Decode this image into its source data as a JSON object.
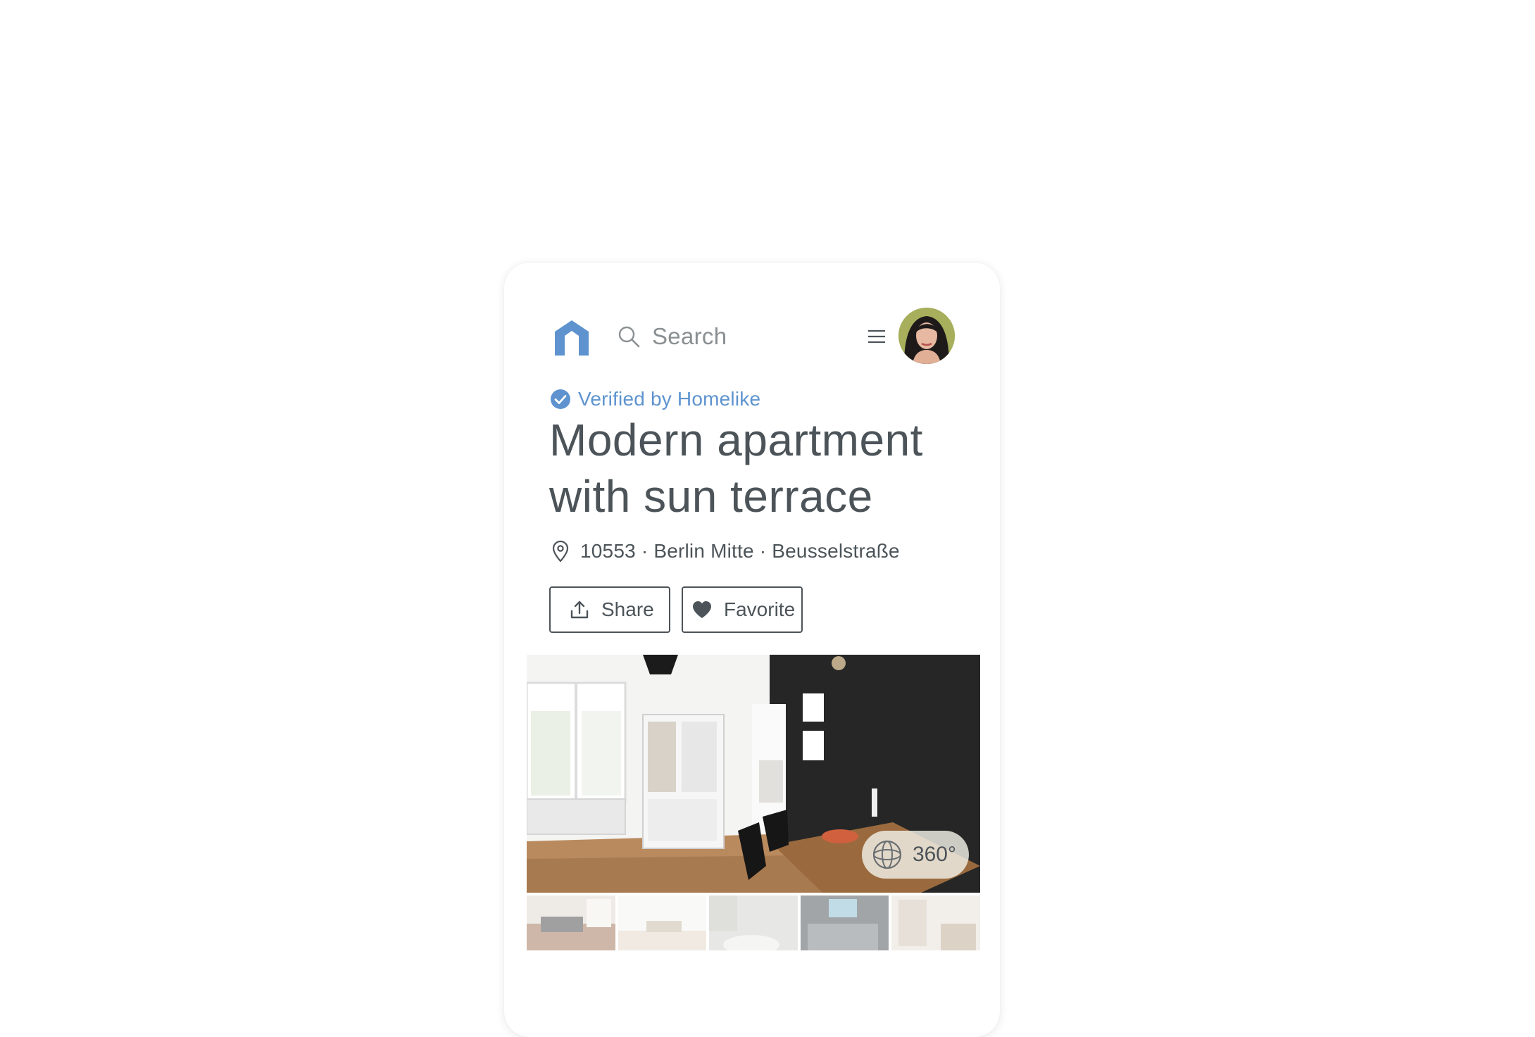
{
  "header": {
    "search_placeholder": "Search"
  },
  "listing": {
    "verified_label": "Verified by Homelike",
    "title": "Modern apartment with sun terrace",
    "location": "10553 · Berlin Mitte · Beusselstraße"
  },
  "actions": {
    "share_label": "Share",
    "favorite_label": "Favorite"
  },
  "gallery": {
    "tour_label": "360°",
    "thumbnail_count": 5
  },
  "colors": {
    "brand_blue": "#5e93cf",
    "text_dark": "#4c5459",
    "muted_text": "#8a8f92"
  },
  "icons": {
    "logo": "homelike-logo-icon",
    "search": "search-icon",
    "menu": "hamburger-menu-icon",
    "verified": "verified-check-icon",
    "location": "map-pin-icon",
    "share": "share-upload-icon",
    "favorite": "heart-icon",
    "tour": "360-tour-icon"
  }
}
